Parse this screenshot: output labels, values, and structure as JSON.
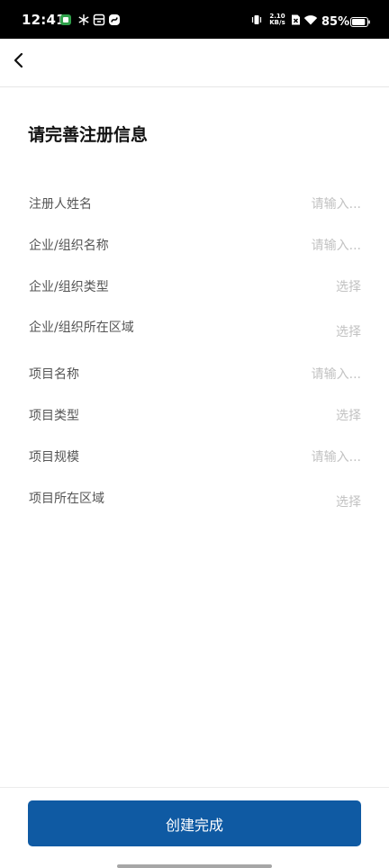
{
  "status_bar": {
    "time": "12:41",
    "net_speed_value": "2.10",
    "net_speed_unit": "KB/s",
    "battery_percent": "85%"
  },
  "icons": {
    "back": "chevron-left-icon"
  },
  "page": {
    "title": "请完善注册信息"
  },
  "form": {
    "fields": [
      {
        "label": "注册人姓名",
        "value": "请输入..."
      },
      {
        "label": "企业/组织名称",
        "value": "请输入..."
      },
      {
        "label": "企业/组织类型",
        "value": "选择"
      },
      {
        "label": "企业/组织所在区域",
        "value": "选择"
      },
      {
        "label": "项目名称",
        "value": "请输入..."
      },
      {
        "label": "项目类型",
        "value": "选择"
      },
      {
        "label": "项目规模",
        "value": "请输入..."
      },
      {
        "label": "项目所在区域",
        "value": "选择"
      }
    ]
  },
  "footer": {
    "submit_label": "创建完成"
  },
  "colors": {
    "primary": "#0f5aa3",
    "label_text": "#555555",
    "placeholder_text": "#c2c2c2"
  }
}
